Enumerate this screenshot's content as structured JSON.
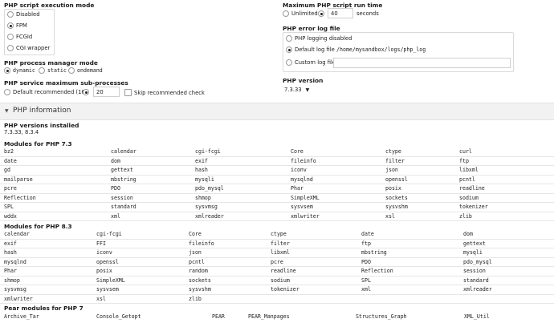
{
  "exec_mode": {
    "label": "PHP script execution mode",
    "options": [
      "Disabled",
      "FPM",
      "FCGId",
      "CGI wrapper"
    ],
    "selected": 1
  },
  "max_run": {
    "label": "Maximum PHP script run time",
    "unlimited": "Unlimited",
    "value": "40",
    "unit": "seconds"
  },
  "error_log": {
    "label": "PHP error log file",
    "options": [
      "PHP logging disabled",
      "Default log file",
      "Custom log file"
    ],
    "default_path": "/home/mysandbox/logs/php_log",
    "selected": 1
  },
  "pm_mode": {
    "label": "PHP process manager mode",
    "options": [
      "dynamic",
      "static",
      "ondemand"
    ],
    "selected": 0
  },
  "sub_proc": {
    "label": "PHP service maximum sub-processes",
    "default_opt": "Default recommended (16)",
    "value": "20",
    "skip": "Skip recommended check"
  },
  "php_version": {
    "label": "PHP version",
    "value": "7.3.33"
  },
  "section": {
    "title": "PHP information",
    "versions_label": "PHP versions installed",
    "versions_value": "7.3.33, 8.3.4"
  },
  "modules73": {
    "label": "Modules for PHP 7.3",
    "rows": [
      [
        "bz2",
        "calendar",
        "cgi-fcgi",
        "Core",
        "ctype",
        "curl"
      ],
      [
        "date",
        "dom",
        "exif",
        "fileinfo",
        "filter",
        "ftp"
      ],
      [
        "gd",
        "gettext",
        "hash",
        "iconv",
        "json",
        "libxml"
      ],
      [
        "mailparse",
        "mbstring",
        "mysqli",
        "mysqlnd",
        "openssl",
        "pcntl"
      ],
      [
        "pcre",
        "PDO",
        "pdo_mysql",
        "Phar",
        "posix",
        "readline"
      ],
      [
        "Reflection",
        "session",
        "shmop",
        "SimpleXML",
        "sockets",
        "sodium"
      ],
      [
        "SPL",
        "standard",
        "sysvmsg",
        "sysvsem",
        "sysvshm",
        "tokenizer"
      ],
      [
        "wddx",
        "xml",
        "xmlreader",
        "xmlwriter",
        "xsl",
        "zlib"
      ]
    ]
  },
  "modules83": {
    "label": "Modules for PHP 8.3",
    "rows": [
      [
        "calendar",
        "cgi-fcgi",
        "Core",
        "ctype",
        "date",
        "dom"
      ],
      [
        "exif",
        "FFI",
        "fileinfo",
        "filter",
        "ftp",
        "gettext"
      ],
      [
        "hash",
        "iconv",
        "json",
        "libxml",
        "mbstring",
        "mysqli"
      ],
      [
        "mysqlnd",
        "openssl",
        "pcntl",
        "pcre",
        "PDO",
        "pdo_mysql"
      ],
      [
        "Phar",
        "posix",
        "random",
        "readline",
        "Reflection",
        "session"
      ],
      [
        "shmop",
        "SimpleXML",
        "sockets",
        "sodium",
        "SPL",
        "standard"
      ],
      [
        "sysvmsg",
        "sysvsem",
        "sysvshm",
        "tokenizer",
        "xml",
        "xmlreader"
      ],
      [
        "xmlwriter",
        "xsl",
        "zlib",
        "",
        "",
        ""
      ]
    ]
  },
  "pear": {
    "label": "Pear modules for PHP 7",
    "items": [
      "Archive_Tar",
      "Console_Getopt",
      "PEAR",
      "PEAR_Manpages",
      "Structures_Graph",
      "XML_Util"
    ]
  }
}
